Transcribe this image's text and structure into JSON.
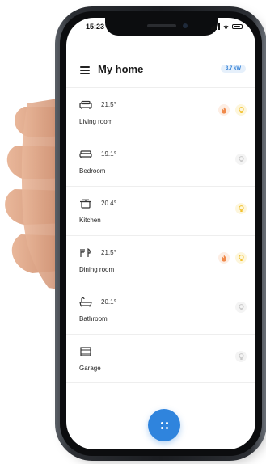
{
  "status": {
    "time": "15:23"
  },
  "header": {
    "title": "My home",
    "energy": "3.7 kW"
  },
  "rooms": [
    {
      "name": "Living room",
      "temp": "21.5°",
      "icon": "sofa-icon",
      "heating": true,
      "light": true
    },
    {
      "name": "Bedroom",
      "temp": "19.1°",
      "icon": "bed-icon",
      "heating": false,
      "light": false
    },
    {
      "name": "Kitchen",
      "temp": "20.4°",
      "icon": "cooking-pot-icon",
      "heating": false,
      "light": true
    },
    {
      "name": "Dining room",
      "temp": "21.5°",
      "icon": "cutlery-icon",
      "heating": true,
      "light": true
    },
    {
      "name": "Bathroom",
      "temp": "20.1°",
      "icon": "bathtub-icon",
      "heating": false,
      "light": false
    },
    {
      "name": "Garage",
      "temp": "",
      "icon": "garage-icon",
      "heating": false,
      "light": false
    }
  ],
  "colors": {
    "accent": "#2f84dd",
    "flame": "#f08a4b",
    "bulb_on": "#f2c12e",
    "bulb_off": "#c8c8c8"
  }
}
